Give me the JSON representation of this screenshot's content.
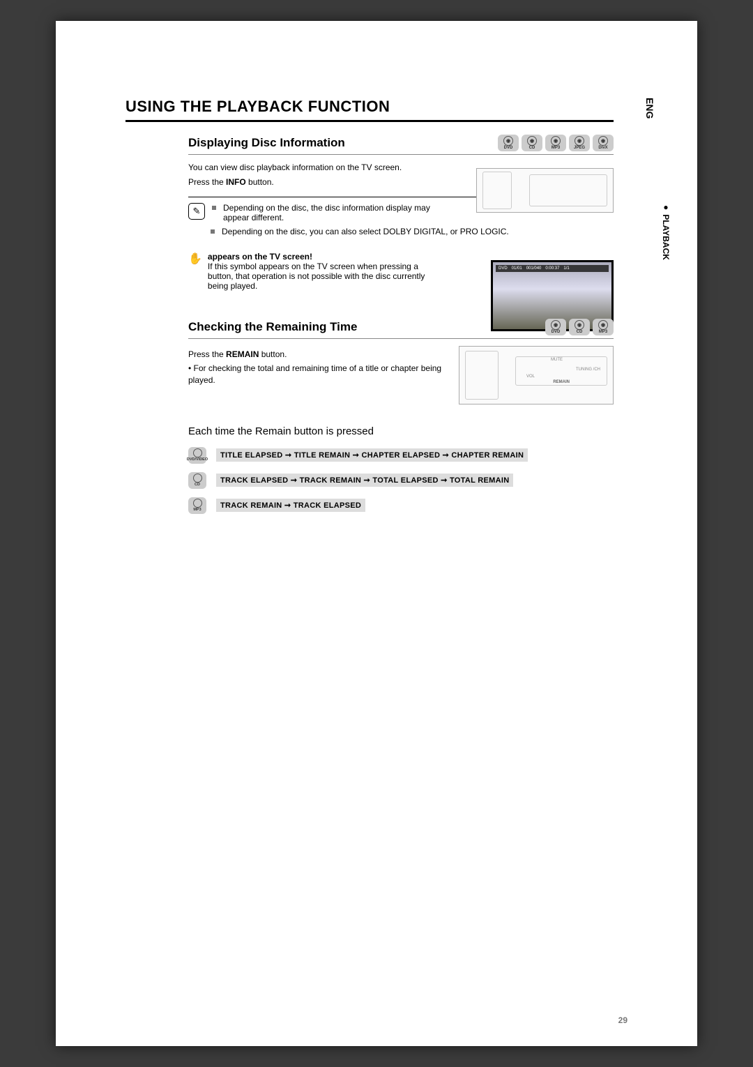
{
  "side": {
    "lang": "ENG",
    "section": "● PLAYBACK"
  },
  "title": "USING THE PLAYBACK FUNCTION",
  "sec1": {
    "heading": "Displaying Disc Information",
    "discs": [
      "DVD",
      "CD",
      "MP3",
      "JPEG",
      "DivX"
    ],
    "intro": "You can view disc playback information  on the TV screen.",
    "press_pre": "Press the ",
    "press_btn": "INFO",
    "press_post": " button.",
    "note1": "Depending on the disc, the disc information display may appear different.",
    "note2": "Depending on the disc, you can also select  DOLBY DIGITAL, or PRO LOGIC.",
    "tv_title": "appears on the TV screen!",
    "tv_body": "If this symbol appears on the TV screen when pressing a button, that operation is not possible with the disc currently being played.",
    "osd": [
      "DVD",
      "01/01",
      "001/040",
      "0:00:37",
      "1/1"
    ]
  },
  "sec2": {
    "heading": "Checking the Remaining Time",
    "discs": [
      "DVD",
      "CD",
      "MP3"
    ],
    "press_pre": "Press the ",
    "press_btn": "REMAIN",
    "press_post": " button.",
    "bullet": "For checking the total and remaining time of a title or chapter being played.",
    "labels": {
      "remain": "REMAIN",
      "mute": "MUTE",
      "vol": "VOL",
      "tuning": "TUNING /CH"
    }
  },
  "sec3": {
    "heading": "Each time the Remain button is pressed",
    "rows": [
      {
        "disc": "DVD/VIDEO",
        "seq": "TITLE ELAPSED ➞ TITLE REMAIN ➞ CHAPTER ELAPSED ➞ CHAPTER REMAIN"
      },
      {
        "disc": "CD",
        "seq": "TRACK ELAPSED ➞ TRACK REMAIN ➞ TOTAL ELAPSED ➞ TOTAL REMAIN"
      },
      {
        "disc": "MP3",
        "seq": "TRACK REMAIN ➞ TRACK ELAPSED"
      }
    ]
  },
  "page_number": "29"
}
